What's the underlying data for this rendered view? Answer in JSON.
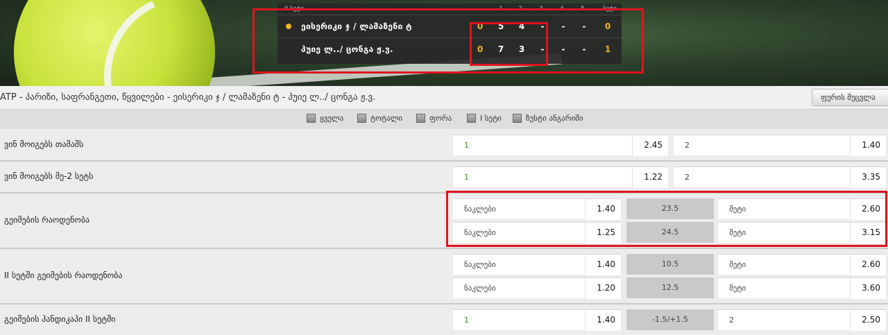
{
  "scoreboard": {
    "header_left": "II სეტი",
    "cols": [
      "1",
      "2",
      "3",
      "4",
      "5",
      "სეტი"
    ],
    "players": [
      {
        "name": "ეისერიკი ჯ / ლამაზენი ტ",
        "games": "0",
        "s1": "5",
        "s2": "4",
        "s3": "-",
        "s4": "-",
        "s5": "-",
        "sets": "0",
        "serving": true
      },
      {
        "name": "პუიე ლ../ ცონგა ჟ.ვ.",
        "games": "0",
        "s1": "7",
        "s2": "3",
        "s3": "-",
        "s4": "-",
        "s5": "-",
        "sets": "1",
        "serving": false
      }
    ]
  },
  "breadcrumb": "ATP - პარიზი, საფრანგეთი, წყვილები - ეისერიკი ჯ / ლამაზენი ტ - პუიე ლ../ ცონგა ჟ.ვ.",
  "color_button": "ფერის შეცვლა",
  "filters": [
    "ყველა",
    "ტოტალი",
    "ფორა",
    "I სეტი",
    "ზუსტი ანგარიში"
  ],
  "markets": [
    {
      "name": "ვინ მოიგებს თამაშს",
      "left_label": "1",
      "left_odd": "2.45",
      "right_label": "2",
      "right_odd": "1.40"
    },
    {
      "name": "ვინ მოიგებს მე-2 სეტს",
      "left_label": "1",
      "left_odd": "1.22",
      "right_label": "2",
      "right_odd": "3.35"
    },
    {
      "name": "გეიმების რაოდენობა",
      "rows": [
        {
          "under": "ნაკლები",
          "under_odd": "1.40",
          "line": "23.5",
          "over": "მეტი",
          "over_odd": "2.60"
        },
        {
          "under": "ნაკლები",
          "under_odd": "1.25",
          "line": "24.5",
          "over": "მეტი",
          "over_odd": "3.15"
        }
      ]
    },
    {
      "name": "II სეტში გეიმების რაოდენობა",
      "rows": [
        {
          "under": "ნაკლები",
          "under_odd": "1.40",
          "line": "10.5",
          "over": "მეტი",
          "over_odd": "2.60"
        },
        {
          "under": "ნაკლები",
          "under_odd": "1.20",
          "line": "12.5",
          "over": "მეტი",
          "over_odd": "3.60"
        }
      ]
    },
    {
      "name": "გეიმების ჰანდიკაპი II სეტში",
      "left_label": "1",
      "left_odd": "1.40",
      "line": "-1.5/+1.5",
      "right_label": "2",
      "right_odd": "2.50"
    }
  ],
  "colors": {
    "highlight": "#e0141e",
    "serve_dot": "#f0b429",
    "score_gold": "#f0b429"
  }
}
